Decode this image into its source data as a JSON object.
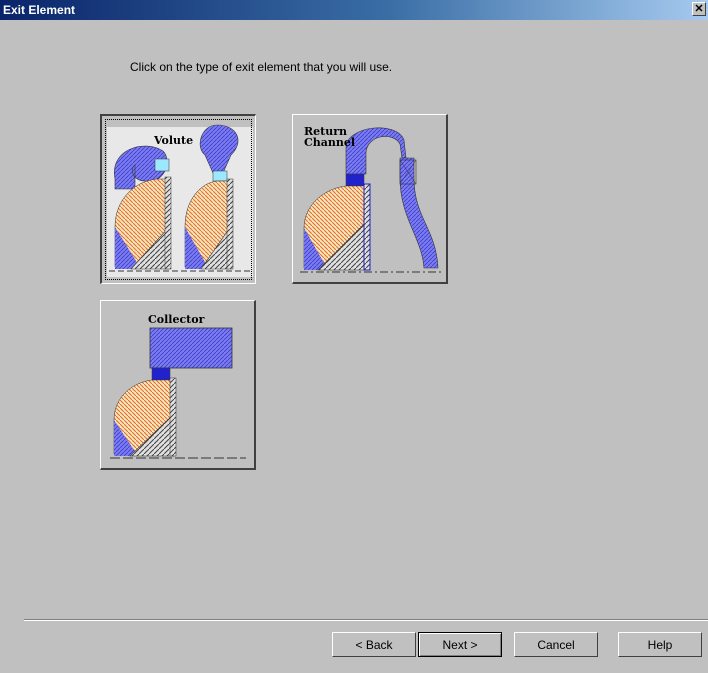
{
  "window": {
    "title": "Exit Element",
    "close_glyph": "✕"
  },
  "instruction": "Click on the type of exit element that you will use.",
  "tiles": [
    {
      "label": "Volute",
      "selected": true
    },
    {
      "label_line1": "Return",
      "label_line2": "Channel",
      "selected": false
    },
    {
      "label": "Collector",
      "selected": false
    }
  ],
  "buttons": {
    "back": "< Back",
    "next": "Next >",
    "cancel": "Cancel",
    "help": "Help"
  },
  "colors": {
    "titlebar": "#0a246a",
    "blue_fill": "#6f70e6",
    "impeller": "#f5c15d",
    "hub_hatch": "#808080"
  }
}
